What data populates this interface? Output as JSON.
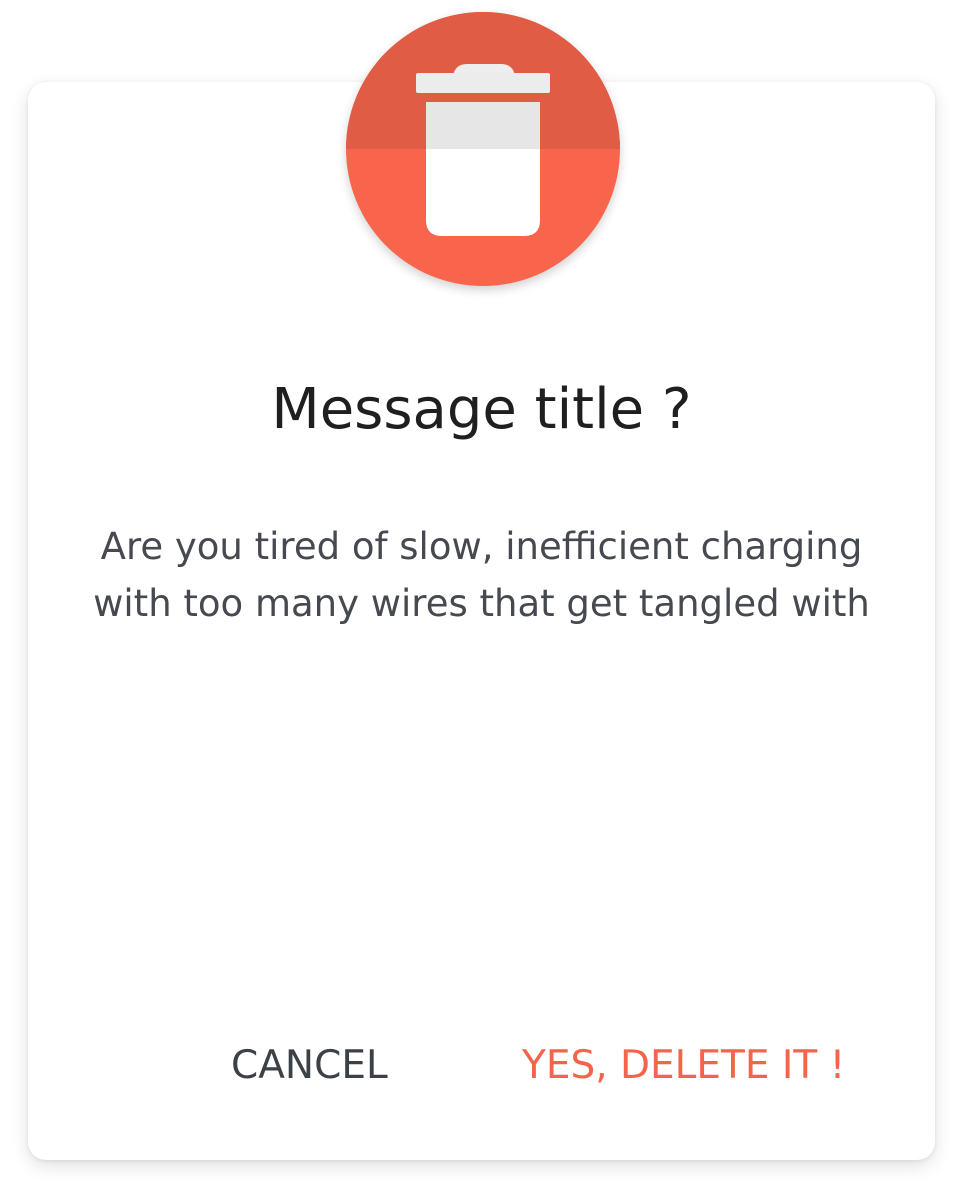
{
  "dialog": {
    "icon": "trash-icon",
    "accent_color": "#f3644a",
    "title": "Message title ?",
    "message_lines": [
      "Are you tired of slow, inefficient charging",
      "with too many wires that get tangled with"
    ],
    "cancel_label": "CANCEL",
    "confirm_label": "YES, DELETE IT !"
  }
}
